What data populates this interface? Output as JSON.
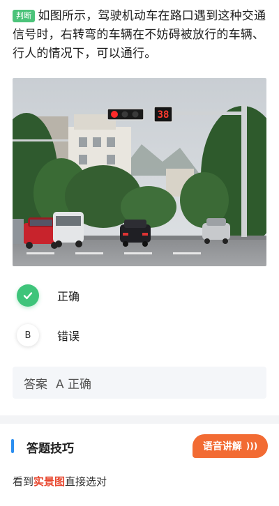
{
  "question": {
    "tag": "判断",
    "text": "如图所示，驾驶机动车在路口遇到这种交通信号时，右转弯的车辆在不妨碍被放行的车辆、行人的情况下，可以通行。"
  },
  "scene": {
    "signal_countdown": "38"
  },
  "options": [
    {
      "marker": "check-icon",
      "label": "正确",
      "state": "correct"
    },
    {
      "marker": "B",
      "label": "错误",
      "state": "default"
    }
  ],
  "answer": {
    "label": "答案",
    "value": "A 正确"
  },
  "tips": {
    "title": "答题技巧",
    "voice_button": "语音讲解",
    "text_prefix": "看到",
    "text_highlight": "实景图",
    "text_suffix": "直接选对"
  },
  "colors": {
    "correct_green": "#3ec47a",
    "tag_green": "#4cc37a",
    "accent_blue": "#2b8ef0",
    "voice_orange": "#f26b33",
    "highlight_red": "#e8472f"
  }
}
